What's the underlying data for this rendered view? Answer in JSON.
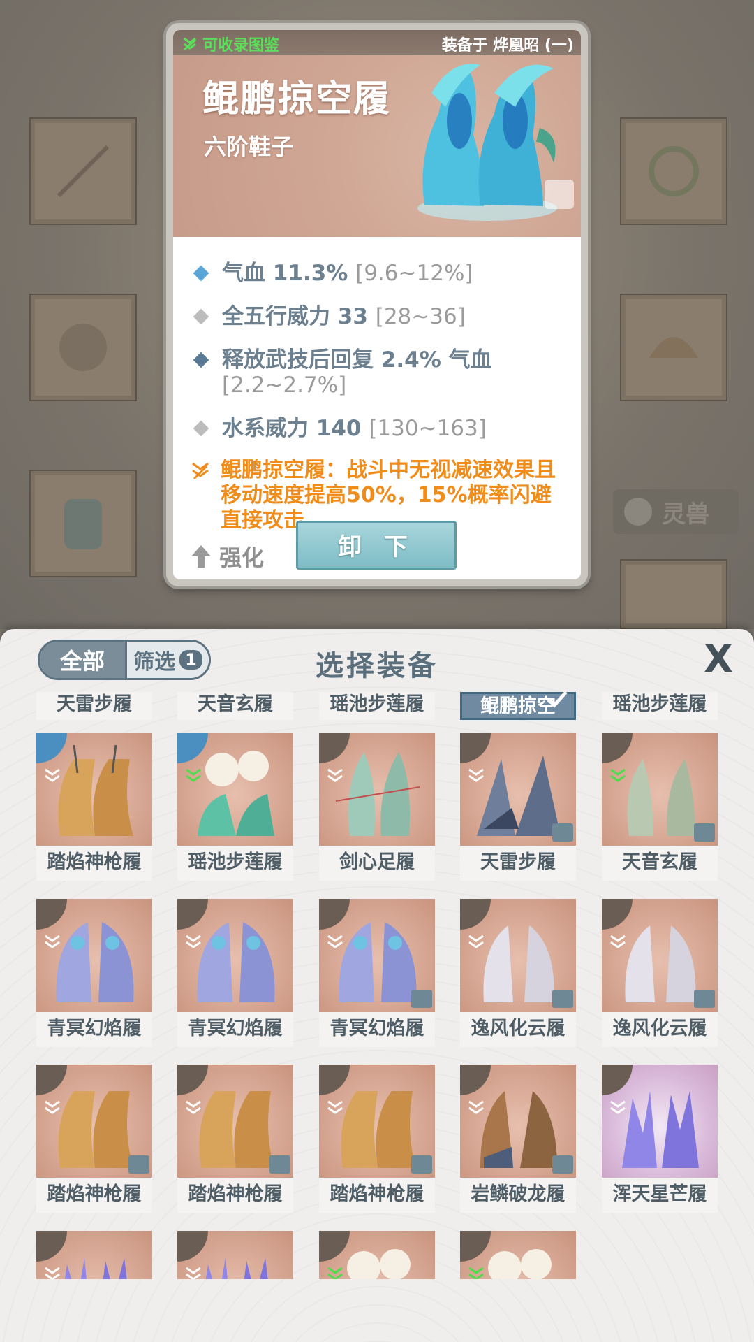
{
  "detail": {
    "collect_label": "可收录图鉴",
    "equipped_label": "装备于 烨凰昭 (一)",
    "item_name": "鲲鹏掠空履",
    "item_grade": "六阶鞋子",
    "stats": [
      {
        "text": "气血 11.3%",
        "range": "[9.6~12%]",
        "color": "#5aa6d6"
      },
      {
        "text": "全五行威力 33",
        "range": "[28~36]",
        "color": "#bcbcbc"
      },
      {
        "text": "释放武技后回复 2.4% 气血",
        "range": "[2.2~2.7%]",
        "color": "#5b7a95"
      },
      {
        "text": "水系威力 140",
        "range": "[130~163]",
        "color": "#bcbcbc"
      }
    ],
    "special_text": "鲲鹏掠空履：战斗中无视减速效果且移动速度提高50%，15%概率闪避直接攻击",
    "enhance_label": "强化",
    "unequip_label": "卸 下"
  },
  "background": {
    "pet_tag": "灵兽"
  },
  "panel": {
    "tab_all": "全部",
    "tab_filter": "筛选",
    "filter_count": "1",
    "title": "选择装备",
    "close_label": "X"
  },
  "top_partial_row": [
    "天雷步履",
    "天音玄履",
    "瑶池步莲履",
    "鲲鹏掠空",
    "瑶池步莲履"
  ],
  "items_row1": [
    "踏焰神枪履",
    "瑶池步莲履",
    "剑心足履",
    "天雷步履",
    "天音玄履"
  ],
  "items_row2": [
    "青冥幻焰履",
    "青冥幻焰履",
    "青冥幻焰履",
    "逸风化云履",
    "逸风化云履"
  ],
  "items_row3": [
    "踏焰神枪履",
    "踏焰神枪履",
    "踏焰神枪履",
    "岩鳞破龙履",
    "浑天星芒履"
  ],
  "colors": {
    "accent_blue": "#5d7280",
    "special_orange": "#f08c1a",
    "collect_green": "#5ce05c",
    "button_teal": "#8ec7cf"
  }
}
